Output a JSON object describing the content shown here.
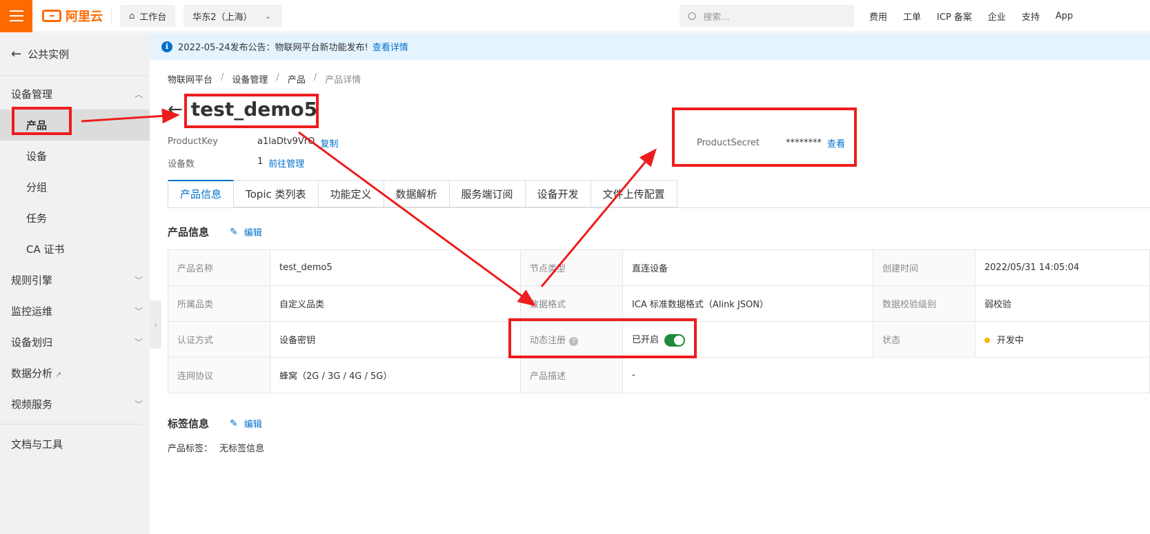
{
  "topbar": {
    "brand": "阿里云",
    "workbench": "工作台",
    "region": "华东2（上海）",
    "search_placeholder": "搜索...",
    "links": [
      "费用",
      "工单",
      "ICP 备案",
      "企业",
      "支持",
      "App"
    ]
  },
  "sidebar": {
    "back": "公共实例",
    "groups": [
      {
        "label": "设备管理",
        "expanded": true,
        "items": [
          "产品",
          "设备",
          "分组",
          "任务",
          "CA 证书"
        ]
      },
      {
        "label": "规则引擎"
      },
      {
        "label": "监控运维"
      },
      {
        "label": "设备划归"
      },
      {
        "label": "数据分析"
      },
      {
        "label": "视频服务"
      }
    ],
    "docs": "文档与工具"
  },
  "notice": {
    "text": "2022-05-24发布公告：物联网平台新功能发布!",
    "link": "查看详情"
  },
  "breadcrumb": [
    "物联网平台",
    "设备管理",
    "产品",
    "产品详情"
  ],
  "product": {
    "title": "test_demo5",
    "product_key_label": "ProductKey",
    "product_key": "a1laDtv9VrO",
    "copy": "复制",
    "device_count_label": "设备数",
    "device_count": "1",
    "manage_link": "前往管理",
    "secret_label": "ProductSecret",
    "secret_mask": "********",
    "secret_view": "查看"
  },
  "tabs": [
    "产品信息",
    "Topic 类列表",
    "功能定义",
    "数据解析",
    "服务端订阅",
    "设备开发",
    "文件上传配置"
  ],
  "section_info": {
    "title": "产品信息",
    "edit": "编辑"
  },
  "info_table": {
    "r1": {
      "k1": "产品名称",
      "v1": "test_demo5",
      "k2": "节点类型",
      "v2": "直连设备",
      "k3": "创建时间",
      "v3": "2022/05/31 14:05:04"
    },
    "r2": {
      "k1": "所属品类",
      "v1": "自定义品类",
      "k2": "数据格式",
      "v2": "ICA 标准数据格式（Alink JSON）",
      "k3": "数据校验级别",
      "v3": "弱校验"
    },
    "r3": {
      "k1": "认证方式",
      "v1": "设备密钥",
      "k2": "动态注册",
      "v2": "已开启",
      "k3": "状态",
      "v3": "开发中"
    },
    "r4": {
      "k1": "连网协议",
      "v1": "蜂窝（2G / 3G / 4G / 5G）",
      "k2": "产品描述",
      "v2": "-"
    }
  },
  "dynamic_register_enabled": true,
  "section_tags": {
    "title": "标签信息",
    "edit": "编辑",
    "label": "产品标签：",
    "value": "无标签信息"
  },
  "annotation_color": "#ee1c1c"
}
